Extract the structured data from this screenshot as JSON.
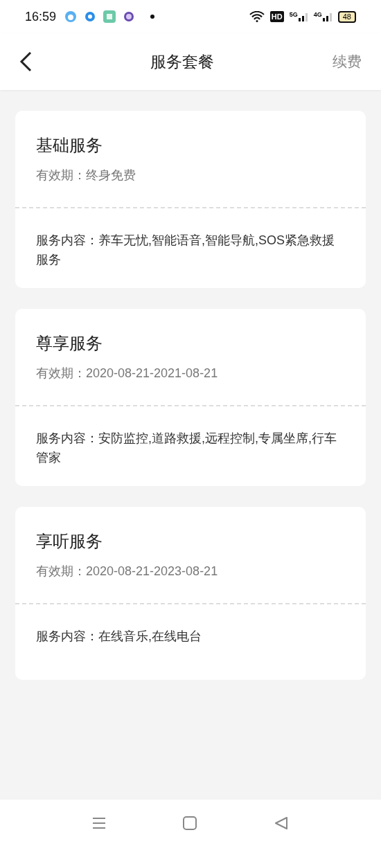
{
  "status_bar": {
    "time": "16:59",
    "hd": "HD",
    "net_1": "5G",
    "net_2": "4G",
    "battery": "48"
  },
  "header": {
    "title": "服务套餐",
    "action": "续费"
  },
  "cards": [
    {
      "title": "基础服务",
      "validity": "有效期：终身免费",
      "content": "服务内容：养车无忧,智能语音,智能导航,SOS紧急救援服务"
    },
    {
      "title": "尊享服务",
      "validity": "有效期：2020-08-21-2021-08-21",
      "content": "服务内容：安防监控,道路救援,远程控制,专属坐席,行车管家"
    },
    {
      "title": "享听服务",
      "validity": "有效期：2020-08-21-2023-08-21",
      "content": "服务内容：在线音乐,在线电台"
    }
  ]
}
